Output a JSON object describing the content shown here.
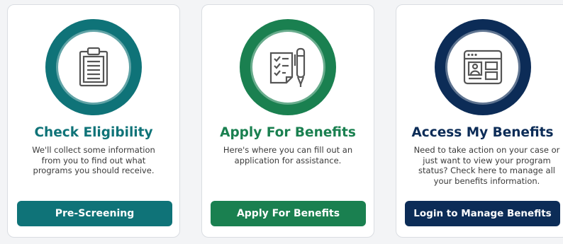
{
  "cards": [
    {
      "title": "Check Eligibility",
      "description": "We'll collect some information from you to find out what programs you should receive.",
      "button_label": "Pre-Screening",
      "icon": "clipboard-icon",
      "color": "#0f7378"
    },
    {
      "title": "Apply For Benefits",
      "description": "Here's where you can fill out an application for assistance.",
      "button_label": "Apply For Benefits",
      "icon": "checklist-pen-icon",
      "color": "#1a8050"
    },
    {
      "title": "Access My Benefits",
      "description": "Need to take action on your case or just want to view your program status? Check here to manage all your benefits information.",
      "button_label": "Login to Manage Benefits",
      "icon": "profile-window-icon",
      "color": "#0c2c57"
    }
  ]
}
